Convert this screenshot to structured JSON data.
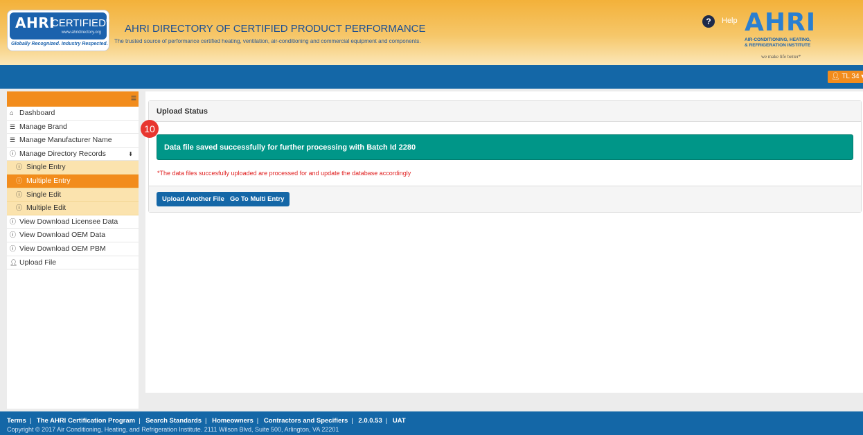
{
  "header": {
    "logo": {
      "brand": "AHRI",
      "certified": "CERTIFIED",
      "trademark": "®",
      "url": "www.ahridirectory.org",
      "tagline": "Globally Recognized. Industry Respected."
    },
    "title": "AHRI DIRECTORY OF CERTIFIED PRODUCT PERFORMANCE",
    "subtitle": "The trusted source of performance certified heating, ventilation, air-conditioning and commercial equipment and components.",
    "help_label": "Help",
    "institute": {
      "mark": "AHRI",
      "line1": "AIR-CONDITIONING, HEATING,",
      "line2": "& REFRIGERATION INSTITUTE",
      "slogan": "we make life better*"
    }
  },
  "topbar": {
    "user_label": "TL 34"
  },
  "sidebar": {
    "items": [
      {
        "label": "Dashboard",
        "icon": "home-icon",
        "glyph": "🏠"
      },
      {
        "label": "Manage Brand",
        "icon": "list-icon",
        "glyph": "☰"
      },
      {
        "label": "Manage Manufacturer Name",
        "icon": "list-icon",
        "glyph": "☰"
      },
      {
        "label": "Manage Directory Records",
        "icon": "info-icon",
        "glyph": "ⓘ",
        "caret": "⬇"
      },
      {
        "label": "Single Entry",
        "icon": "info-icon",
        "glyph": "ⓘ"
      },
      {
        "label": "Multiple Entry",
        "icon": "info-icon",
        "glyph": "ⓘ"
      },
      {
        "label": "Single Edit",
        "icon": "info-icon",
        "glyph": "ⓘ"
      },
      {
        "label": "Multiple Edit",
        "icon": "info-icon",
        "glyph": "ⓘ"
      },
      {
        "label": "View Download Licensee Data",
        "icon": "download-icon",
        "glyph": "ⓘ"
      },
      {
        "label": "View Download OEM Data",
        "icon": "download-icon",
        "glyph": "ⓘ"
      },
      {
        "label": "View Download OEM PBM",
        "icon": "download-icon",
        "glyph": "ⓘ"
      },
      {
        "label": "Upload File",
        "icon": "user-icon",
        "glyph": "👤"
      }
    ]
  },
  "panel": {
    "title": "Upload Status",
    "step_number": "10",
    "success_message": "Data file saved successfully for further processing with Batch Id 2280",
    "note": "*The data files succesfully uploaded are processed for and update the database accordingly",
    "buttons": {
      "upload_another": "Upload Another File",
      "go_multi": "Go To Multi Entry"
    }
  },
  "footer": {
    "links": [
      "Terms",
      "The AHRI Certification Program",
      "Search Standards",
      "Homeowners",
      "Contractors and Specifiers",
      "2.0.0.53",
      "UAT"
    ],
    "copyright": "Copyright © 2017 Air Conditioning, Heating, and Refrigeration Institute. 2111 Wilson Blvd, Suite 500, Arlington, VA 22201"
  },
  "colors": {
    "accent_orange": "#f28c1c",
    "brand_blue": "#1467a7",
    "success_green": "#009688",
    "alert_red": "#e02020"
  }
}
